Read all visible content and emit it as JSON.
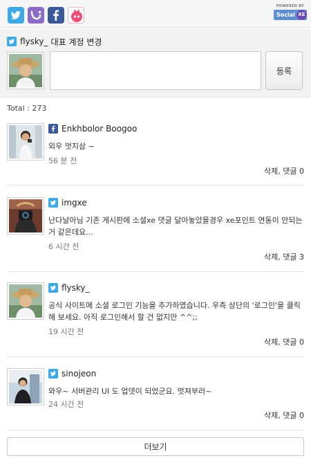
{
  "services": [
    {
      "name": "twitter",
      "color": "#3fa9e8"
    },
    {
      "name": "me2day",
      "color": "#8a6bc6"
    },
    {
      "name": "facebook",
      "color": "#3b5998"
    },
    {
      "name": "yozm",
      "color": "#ef4d72"
    }
  ],
  "powered_by": {
    "label": "POWERED BY",
    "brand": "Social",
    "mark": "XE"
  },
  "composer": {
    "account_name": "flysky_",
    "change_account_label": "대표 계정 변경",
    "input_value": "",
    "submit_label": "등록"
  },
  "total_label": "Total : 273",
  "posts": [
    {
      "service": "facebook-icon",
      "author": "Enkhbolor Boogoo",
      "body": "외우 멋지삼 ~",
      "time": "56 분 전",
      "delete_label": "삭제",
      "reply_label": "댓글 0"
    },
    {
      "service": "twitter-icon",
      "author": "imgxe",
      "body": "난다날아님 기존 게시판에 소셜xe 댓글 달아놓았을경우 xe포인트 연동이 안되는거 같은데요...",
      "time": "6 시간 전",
      "delete_label": "삭제",
      "reply_label": "댓글 3"
    },
    {
      "service": "twitter-icon",
      "author": "flysky_",
      "body": "공식 사이트에 소셜 로그인 기능을 추가하였습니다. 우측 상단의 '로그인'을 클릭해 보세요. 아직 로그인해서 할 건 없지만 ^^;;",
      "time": "19 시간 전",
      "delete_label": "삭제",
      "reply_label": "댓글 0"
    },
    {
      "service": "twitter-icon",
      "author": "sinojeon",
      "body": "와우~ 서버관리 UI 도 업뎃이 되었군요. 멋져부러~",
      "time": "24 시간 전",
      "delete_label": "삭제",
      "reply_label": "댓글 0"
    }
  ],
  "action_separator": ", ",
  "more_label": "더보기"
}
